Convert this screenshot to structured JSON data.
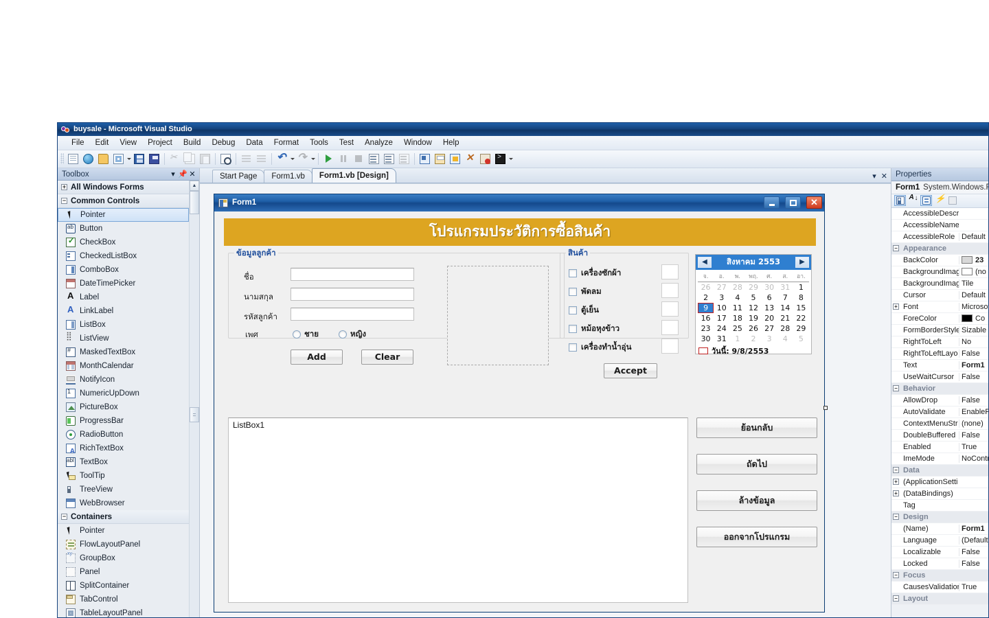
{
  "window": {
    "title": "buysale - Microsoft Visual Studio",
    "logo_icon": "visual-studio-logo-icon"
  },
  "menubar": [
    "File",
    "Edit",
    "View",
    "Project",
    "Build",
    "Debug",
    "Data",
    "Format",
    "Tools",
    "Test",
    "Analyze",
    "Window",
    "Help"
  ],
  "toolbar": {
    "icons": [
      {
        "name": "new-project-icon",
        "cls": "ic-doc",
        "dim": false
      },
      {
        "name": "add-new-web-site-icon",
        "cls": "ic-globe",
        "dim": false
      },
      {
        "name": "open-file-icon",
        "cls": "ic-folder",
        "dim": false
      },
      {
        "name": "add-new-item-icon",
        "cls": "ic-grid",
        "dim": false,
        "caret": true
      },
      {
        "name": "save-icon",
        "cls": "ic-save",
        "dim": false
      },
      {
        "name": "save-all-icon",
        "cls": "ic-saveall",
        "dim": false
      },
      {
        "name": "sep",
        "cls": "sep"
      },
      {
        "name": "cut-icon",
        "cls": "ic-cut",
        "dim": true
      },
      {
        "name": "copy-icon",
        "cls": "ic-copy",
        "dim": true
      },
      {
        "name": "paste-icon",
        "cls": "ic-paste",
        "dim": true
      },
      {
        "name": "sep",
        "cls": "sep"
      },
      {
        "name": "find-icon",
        "cls": "ic-find",
        "dim": false
      },
      {
        "name": "sep",
        "cls": "sep"
      },
      {
        "name": "comment-lines-icon",
        "cls": "ic-lines",
        "dim": true
      },
      {
        "name": "uncomment-lines-icon",
        "cls": "ic-lines",
        "dim": true
      },
      {
        "name": "sep",
        "cls": "sep"
      },
      {
        "name": "undo-icon",
        "cls": "ic-undo",
        "dim": false,
        "caret": true
      },
      {
        "name": "redo-icon",
        "cls": "ic-redo",
        "dim": true,
        "caret": true
      },
      {
        "name": "sep",
        "cls": "sep"
      },
      {
        "name": "start-debugging-icon",
        "cls": "ic-play",
        "dim": false
      },
      {
        "name": "pause-icon",
        "cls": "ic-pause",
        "dim": true
      },
      {
        "name": "stop-icon",
        "cls": "ic-stop",
        "dim": true
      },
      {
        "name": "step-into-icon",
        "cls": "ic-step",
        "dim": false
      },
      {
        "name": "step-over-icon",
        "cls": "ic-step",
        "dim": false
      },
      {
        "name": "step-out-icon",
        "cls": "ic-step",
        "dim": true
      },
      {
        "name": "sep",
        "cls": "sep"
      },
      {
        "name": "solution-explorer-icon",
        "cls": "ic-win1",
        "dim": false
      },
      {
        "name": "properties-window-icon",
        "cls": "ic-win2",
        "dim": false
      },
      {
        "name": "object-browser-icon",
        "cls": "ic-win3",
        "dim": false
      },
      {
        "name": "toolbox-icon",
        "cls": "ic-tools",
        "dim": false
      },
      {
        "name": "error-list-icon",
        "cls": "ic-errbox",
        "dim": false
      },
      {
        "name": "command-window-icon",
        "cls": "ic-cmd",
        "dim": false,
        "caret": true
      }
    ]
  },
  "toolbox": {
    "title": "Toolbox",
    "header_buttons": [
      "chevron-down-icon",
      "pin-icon",
      "close-icon"
    ],
    "groups": [
      {
        "label": "All Windows Forms",
        "expanded": false,
        "items": []
      },
      {
        "label": "Common Controls",
        "expanded": true,
        "items": [
          {
            "label": "Pointer",
            "icon": "ti-pointer",
            "selected": true
          },
          {
            "label": "Button",
            "icon": "ti-button"
          },
          {
            "label": "CheckBox",
            "icon": "ti-checkbox"
          },
          {
            "label": "CheckedListBox",
            "icon": "ti-clb"
          },
          {
            "label": "ComboBox",
            "icon": "ti-combo"
          },
          {
            "label": "DateTimePicker",
            "icon": "ti-dtp"
          },
          {
            "label": "Label",
            "icon": "ti-label"
          },
          {
            "label": "LinkLabel",
            "icon": "ti-linklabel"
          },
          {
            "label": "ListBox",
            "icon": "ti-listbox"
          },
          {
            "label": "ListView",
            "icon": "ti-listview"
          },
          {
            "label": "MaskedTextBox",
            "icon": "ti-mtb"
          },
          {
            "label": "MonthCalendar",
            "icon": "ti-monthcal"
          },
          {
            "label": "NotifyIcon",
            "icon": "ti-notify"
          },
          {
            "label": "NumericUpDown",
            "icon": "ti-numud"
          },
          {
            "label": "PictureBox",
            "icon": "ti-picbox"
          },
          {
            "label": "ProgressBar",
            "icon": "ti-progress"
          },
          {
            "label": "RadioButton",
            "icon": "ti-radio"
          },
          {
            "label": "RichTextBox",
            "icon": "ti-rtb"
          },
          {
            "label": "TextBox",
            "icon": "ti-textbox"
          },
          {
            "label": "ToolTip",
            "icon": "ti-tooltip"
          },
          {
            "label": "TreeView",
            "icon": "ti-treeview"
          },
          {
            "label": "WebBrowser",
            "icon": "ti-webbrowser"
          }
        ]
      },
      {
        "label": "Containers",
        "expanded": true,
        "items": [
          {
            "label": "Pointer",
            "icon": "ti-pointer"
          },
          {
            "label": "FlowLayoutPanel",
            "icon": "ti-flp"
          },
          {
            "label": "GroupBox",
            "icon": "ti-groupbox"
          },
          {
            "label": "Panel",
            "icon": "ti-panel"
          },
          {
            "label": "SplitContainer",
            "icon": "ti-splitc"
          },
          {
            "label": "TabControl",
            "icon": "ti-tabc"
          },
          {
            "label": "TableLayoutPanel",
            "icon": "ti-tlp"
          }
        ]
      }
    ]
  },
  "tabs": [
    {
      "label": "Start Page",
      "active": false
    },
    {
      "label": "Form1.vb",
      "active": false
    },
    {
      "label": "Form1.vb [Design]",
      "active": true
    }
  ],
  "tab_controls": [
    "chevron-down-icon",
    "close-icon"
  ],
  "form": {
    "title": "Form1",
    "icon": "form-designer-icon",
    "window_buttons": [
      "minimize-button",
      "maximize-button",
      "close-button"
    ],
    "banner": "โปรแกรมประวัติการซื้อสินค้า",
    "banner_color": "#dda521",
    "customer_group": {
      "title": "ข้อมูลลูกค้า",
      "fields": [
        {
          "label": "ชื่อ",
          "value": ""
        },
        {
          "label": "นามสกุล",
          "value": ""
        },
        {
          "label": "รหัสลูกค้า",
          "value": ""
        }
      ],
      "gender_label": "เพศ",
      "gender_options": [
        "ชาย",
        "หญิง"
      ],
      "buttons": [
        "Add",
        "Clear"
      ]
    },
    "product_group": {
      "title": "สินค้า",
      "items": [
        "เครื่องซักผ้า",
        "พัดลม",
        "ตู้เย็น",
        "หม้อหุงข้าว",
        "เครื่องทำน้ำอุ่น"
      ],
      "accept_button": "Accept"
    },
    "calendar": {
      "prev_icon": "chevron-left-icon",
      "next_icon": "chevron-right-icon",
      "title": "สิงหาคม 2553",
      "dow": [
        "จ.",
        "อ.",
        "พ.",
        "พฤ.",
        "ศ.",
        "ส.",
        "อา."
      ],
      "weeks": [
        [
          {
            "d": "26",
            "out": true
          },
          {
            "d": "27",
            "out": true
          },
          {
            "d": "28",
            "out": true
          },
          {
            "d": "29",
            "out": true
          },
          {
            "d": "30",
            "out": true
          },
          {
            "d": "31",
            "out": true
          },
          {
            "d": "1"
          }
        ],
        [
          {
            "d": "2"
          },
          {
            "d": "3"
          },
          {
            "d": "4"
          },
          {
            "d": "5"
          },
          {
            "d": "6"
          },
          {
            "d": "7"
          },
          {
            "d": "8"
          }
        ],
        [
          {
            "d": "9",
            "sel": true
          },
          {
            "d": "10"
          },
          {
            "d": "11"
          },
          {
            "d": "12"
          },
          {
            "d": "13"
          },
          {
            "d": "14"
          },
          {
            "d": "15"
          }
        ],
        [
          {
            "d": "16"
          },
          {
            "d": "17"
          },
          {
            "d": "18"
          },
          {
            "d": "19"
          },
          {
            "d": "20"
          },
          {
            "d": "21"
          },
          {
            "d": "22"
          }
        ],
        [
          {
            "d": "23"
          },
          {
            "d": "24"
          },
          {
            "d": "25"
          },
          {
            "d": "26"
          },
          {
            "d": "27"
          },
          {
            "d": "28"
          },
          {
            "d": "29"
          }
        ],
        [
          {
            "d": "30"
          },
          {
            "d": "31"
          },
          {
            "d": "1",
            "out": true
          },
          {
            "d": "2",
            "out": true
          },
          {
            "d": "3",
            "out": true
          },
          {
            "d": "4",
            "out": true
          },
          {
            "d": "5",
            "out": true
          }
        ]
      ],
      "today_label": "วันนี้: 9/8/2553"
    },
    "listbox": {
      "text": "ListBox1"
    },
    "side_buttons": [
      "ย้อนกลับ",
      "ถัดไป",
      "ล้างข้อมูล",
      "ออกจากโปรแกรม"
    ]
  },
  "properties": {
    "title": "Properties",
    "object_name": "Form1",
    "object_type": "System.Windows.Fo",
    "toolbar_icons": [
      "categorized-icon",
      "alphabetical-icon",
      "properties-icon",
      "events-icon",
      "property-pages-icon"
    ],
    "rows": [
      {
        "name": "AccessibleDescri",
        "value": ""
      },
      {
        "name": "AccessibleName",
        "value": ""
      },
      {
        "name": "AccessibleRole",
        "value": "Default"
      },
      {
        "cat": "Appearance",
        "expanded": true
      },
      {
        "name": "BackColor",
        "value": "23",
        "swatch": "#d8d8d8",
        "bold": true
      },
      {
        "name": "BackgroundImag",
        "value": "(no",
        "swatch": "#ffffff"
      },
      {
        "name": "BackgroundImag",
        "value": "Tile"
      },
      {
        "name": "Cursor",
        "value": "Default"
      },
      {
        "name": "Font",
        "value": "Microsof",
        "exp": "+"
      },
      {
        "name": "ForeColor",
        "value": "Co",
        "swatch": "#000000"
      },
      {
        "name": "FormBorderStyle",
        "value": "Sizable"
      },
      {
        "name": "RightToLeft",
        "value": "No"
      },
      {
        "name": "RightToLeftLayo",
        "value": "False"
      },
      {
        "name": "Text",
        "value": "Form1",
        "bold": true
      },
      {
        "name": "UseWaitCursor",
        "value": "False"
      },
      {
        "cat": "Behavior",
        "expanded": true
      },
      {
        "name": "AllowDrop",
        "value": "False"
      },
      {
        "name": "AutoValidate",
        "value": "EnablePr"
      },
      {
        "name": "ContextMenuStr",
        "value": "(none)"
      },
      {
        "name": "DoubleBuffered",
        "value": "False"
      },
      {
        "name": "Enabled",
        "value": "True"
      },
      {
        "name": "ImeMode",
        "value": "NoContr"
      },
      {
        "cat": "Data",
        "expanded": true
      },
      {
        "name": "(ApplicationSetti",
        "value": "",
        "exp": "+"
      },
      {
        "name": "(DataBindings)",
        "value": "",
        "exp": "+"
      },
      {
        "name": "Tag",
        "value": ""
      },
      {
        "cat": "Design",
        "expanded": true
      },
      {
        "name": "(Name)",
        "value": "Form1",
        "bold": true
      },
      {
        "name": "Language",
        "value": "(Default)"
      },
      {
        "name": "Localizable",
        "value": "False"
      },
      {
        "name": "Locked",
        "value": "False"
      },
      {
        "cat": "Focus",
        "expanded": true
      },
      {
        "name": "CausesValidation",
        "value": "True"
      },
      {
        "cat": "Layout",
        "expanded": true
      }
    ]
  }
}
